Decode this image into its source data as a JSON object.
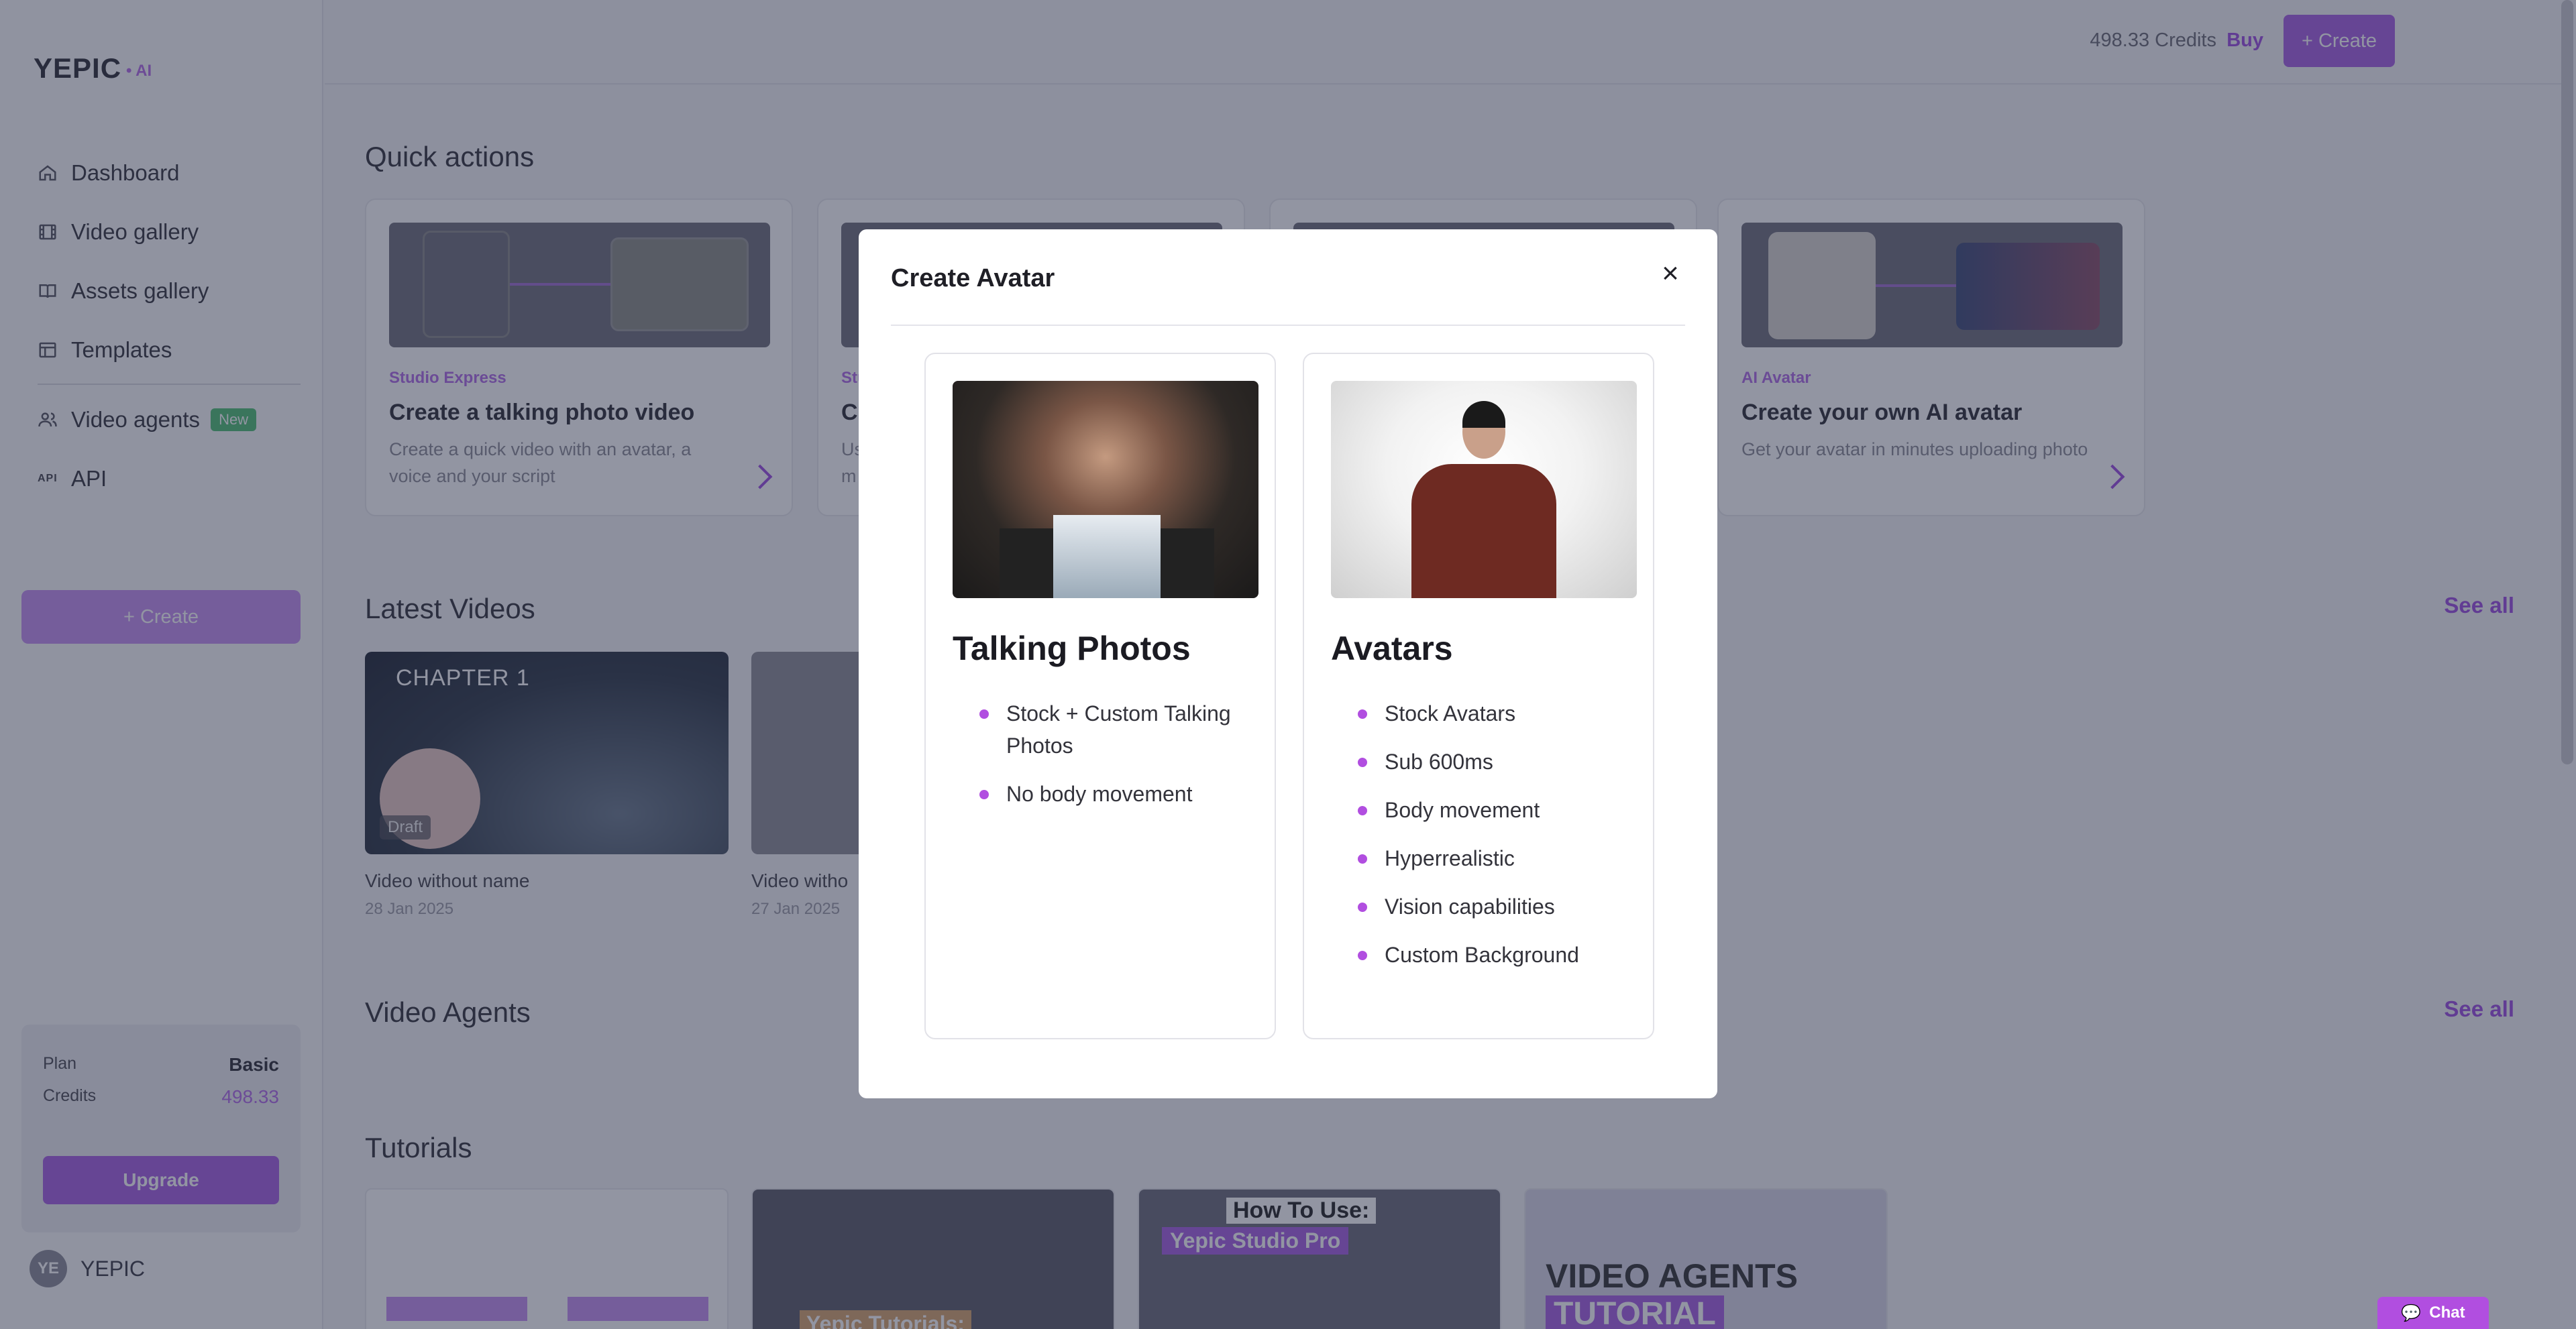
{
  "app": {
    "logo": "YEPIC",
    "logo_suffix": "• AI"
  },
  "sidebar": {
    "items": [
      {
        "label": "Dashboard",
        "icon": "home-icon"
      },
      {
        "label": "Video gallery",
        "icon": "film-icon"
      },
      {
        "label": "Assets gallery",
        "icon": "book-icon"
      },
      {
        "label": "Templates",
        "icon": "layout-icon"
      },
      {
        "label": "Video agents",
        "icon": "users-icon",
        "badge": "New"
      },
      {
        "label": "API",
        "icon": "api-icon",
        "glyph": "API"
      }
    ],
    "create_label": "+ Create",
    "plan": {
      "plan_label": "Plan",
      "plan_value": "Basic",
      "credits_label": "Credits",
      "credits_value": "498.33",
      "upgrade_label": "Upgrade"
    },
    "user": {
      "initials": "YE",
      "name": "YEPIC"
    }
  },
  "topbar": {
    "credits": "498.33 Credits",
    "buy": "Buy",
    "create": "+ Create"
  },
  "sections": {
    "quick_actions": "Quick actions",
    "latest_videos": "Latest Videos",
    "video_agents": "Video Agents",
    "tutorials": "Tutorials",
    "see_all": "See all"
  },
  "quick_actions": [
    {
      "tag": "Studio Express",
      "title": "Create a talking photo video",
      "desc": "Create a quick video with an avatar, a voice and your script"
    },
    {
      "tag": "Stu",
      "title": "Cr",
      "desc": "Us m"
    },
    {
      "tag": "",
      "title": "",
      "desc": ""
    },
    {
      "tag": "AI Avatar",
      "title": "Create your own AI avatar",
      "desc": "Get your avatar in minutes uploading photo"
    }
  ],
  "videos": [
    {
      "name": "Video without name",
      "date": "28 Jan 2025",
      "chapter": "CHAPTER 1",
      "badge": "Draft"
    },
    {
      "name": "Video witho",
      "date": "27 Jan 2025"
    }
  ],
  "tutorials": [
    {
      "label": ""
    },
    {
      "label": "Yepic Tutorials:"
    },
    {
      "label": "How To Use:",
      "sub": "Yepic Studio Pro"
    },
    {
      "label": "VIDEO AGENTS",
      "sub": "TUTORIAL"
    }
  ],
  "modal": {
    "title": "Create Avatar",
    "close": "×",
    "options": [
      {
        "title": "Talking Photos",
        "features": [
          "Stock + Custom Talking Photos",
          "No body movement"
        ]
      },
      {
        "title": "Avatars",
        "features": [
          "Stock Avatars",
          "Sub 600ms",
          "Body movement",
          "Hyperrealistic",
          "Vision capabilities",
          "Custom Background"
        ]
      }
    ]
  },
  "chat": {
    "label": "Chat"
  },
  "colors": {
    "accent": "#a65fe2",
    "bullet": "#b14ee0",
    "overlay": "rgba(38,44,70,0.5)"
  }
}
